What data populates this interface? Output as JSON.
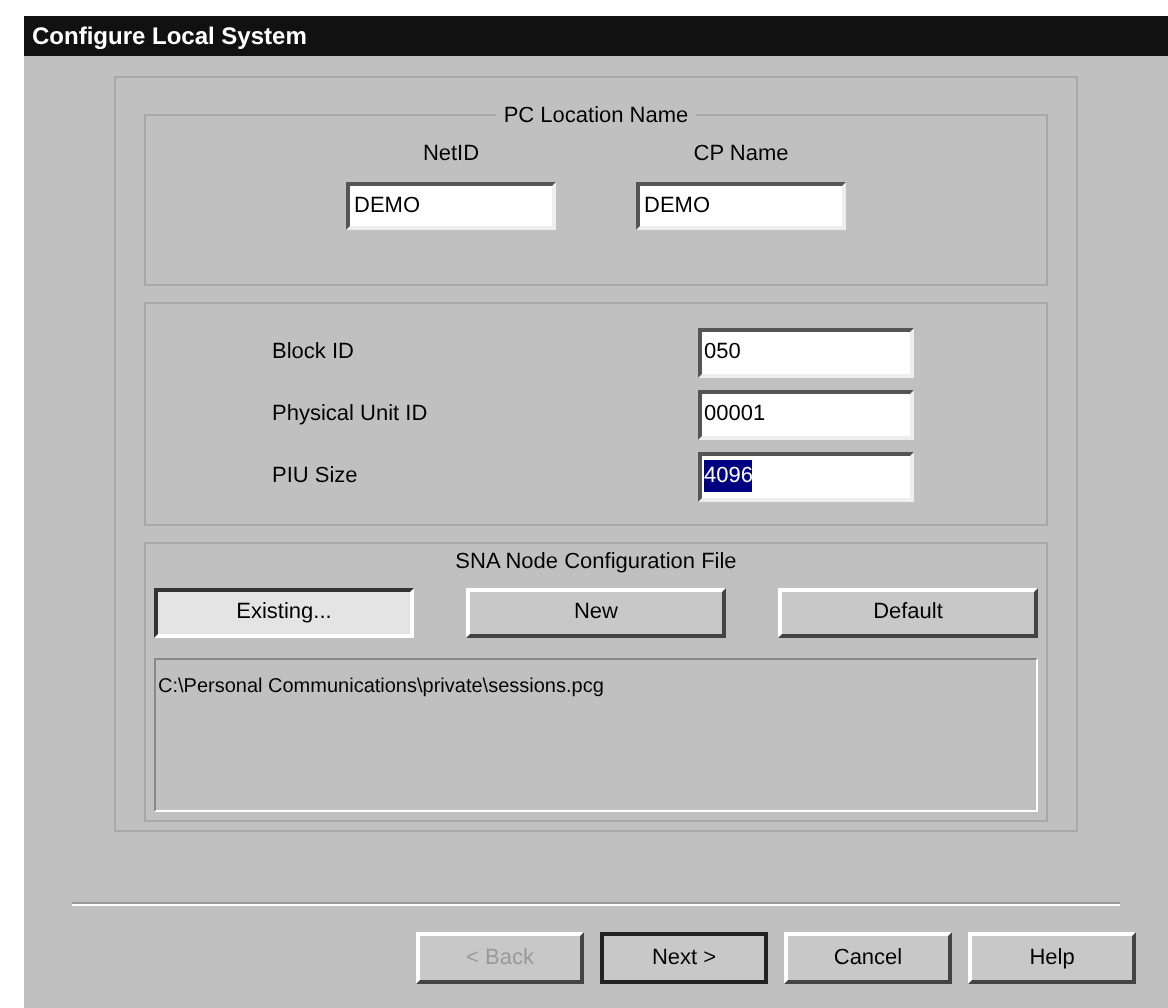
{
  "window": {
    "title": "Configure Local System"
  },
  "pc_location": {
    "title": "PC Location Name",
    "fields": [
      {
        "label": "NetID",
        "value": "DEMO"
      },
      {
        "label": "CP Name",
        "value": "DEMO"
      }
    ]
  },
  "ids": [
    {
      "label": "Block ID",
      "value": "050",
      "selected": false
    },
    {
      "label": "Physical Unit ID",
      "value": "00001",
      "selected": false
    },
    {
      "label": "PIU Size",
      "value": "4096",
      "selected": true
    }
  ],
  "config_file": {
    "title": "SNA Node Configuration File",
    "buttons": [
      {
        "label": "Existing...",
        "selected": true
      },
      {
        "label": "New",
        "selected": false
      },
      {
        "label": "Default",
        "selected": false
      }
    ],
    "path": "C:\\Personal Communications\\private\\sessions.pcg"
  },
  "footer_buttons": [
    {
      "label": "< Back",
      "disabled": true,
      "default": false
    },
    {
      "label": "Next >",
      "disabled": false,
      "default": true
    },
    {
      "label": "Cancel",
      "disabled": false,
      "default": false
    },
    {
      "label": "Help",
      "disabled": false,
      "default": false
    }
  ]
}
